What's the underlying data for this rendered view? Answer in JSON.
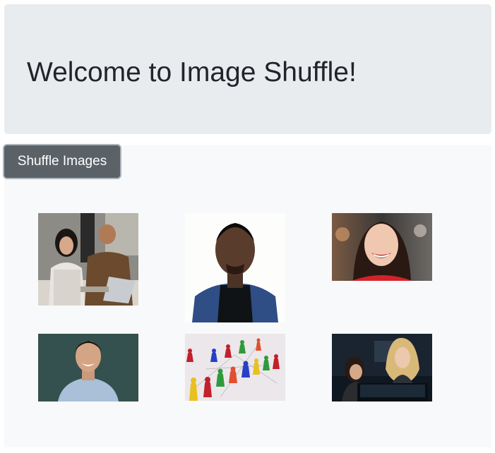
{
  "header": {
    "title": "Welcome to Image Shuffle!"
  },
  "controls": {
    "shuffle_label": "Shuffle Images"
  },
  "gallery": {
    "images": [
      {
        "name": "coworkers-laptop-image",
        "alt": ""
      },
      {
        "name": "man-blue-blazer-image",
        "alt": ""
      },
      {
        "name": "smiling-woman-red-image",
        "alt": ""
      },
      {
        "name": "smiling-man-blue-shirt-image",
        "alt": ""
      },
      {
        "name": "colored-game-pieces-image",
        "alt": ""
      },
      {
        "name": "two-women-computer-image",
        "alt": ""
      }
    ]
  },
  "colors": {
    "jumbotron_bg": "#e9ecef",
    "container_bg": "#f8f9fa",
    "button_bg": "#5a6268",
    "button_text": "#ffffff"
  }
}
